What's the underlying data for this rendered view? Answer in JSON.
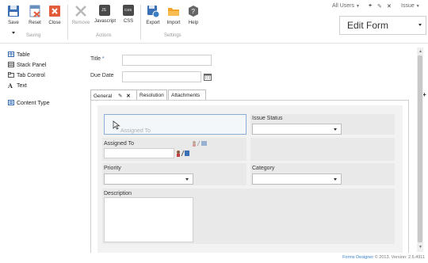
{
  "ribbon": {
    "saving_group": {
      "label": "Saving",
      "buttons": [
        {
          "label": "Save"
        },
        {
          "label": "Reset"
        },
        {
          "label": "Close"
        }
      ]
    },
    "actions_group": {
      "label": "Actions",
      "buttons": [
        {
          "label": "Remove"
        },
        {
          "label": "Javascript"
        },
        {
          "label": "CSS"
        }
      ]
    },
    "settings_group": {
      "label": "Settings",
      "buttons": [
        {
          "label": "Export"
        },
        {
          "label": "Import"
        },
        {
          "label": "Help"
        }
      ]
    },
    "js_badge": "JS",
    "css_badge": "CSS",
    "users_filter": "All Users",
    "issue_label": "Issue",
    "form_selector": "Edit Form"
  },
  "left_panel": {
    "items": [
      {
        "label": "Table"
      },
      {
        "label": "Stack Panel"
      },
      {
        "label": "Tab Control"
      },
      {
        "label": "Text",
        "glyph": "A"
      },
      {
        "label": "Content Type"
      }
    ]
  },
  "form": {
    "title_label": "Title",
    "required_mark": "*",
    "title_value": "",
    "due_date_label": "Due Date",
    "due_date_value": "",
    "tabs": [
      {
        "label": "General"
      },
      {
        "label": "Resolution"
      },
      {
        "label": "Attachments"
      }
    ],
    "add_tab": "+",
    "drag_ghost_text": "Assigned To",
    "assigned_to_label": "Assigned To",
    "issue_status_label": "Issue Status",
    "priority_label": "Priority",
    "category_label": "Category",
    "description_label": "Description"
  },
  "footer": {
    "brand": "Forms Designer",
    "rest": "© 2013. Version: 2.6.4911"
  },
  "colors": {
    "accent": "#3a7fc4",
    "close_red": "#e25b3b",
    "folder_orange": "#f3a52a",
    "cell_gray": "#e9e9e9",
    "panel_gray": "#f2f2f2"
  }
}
